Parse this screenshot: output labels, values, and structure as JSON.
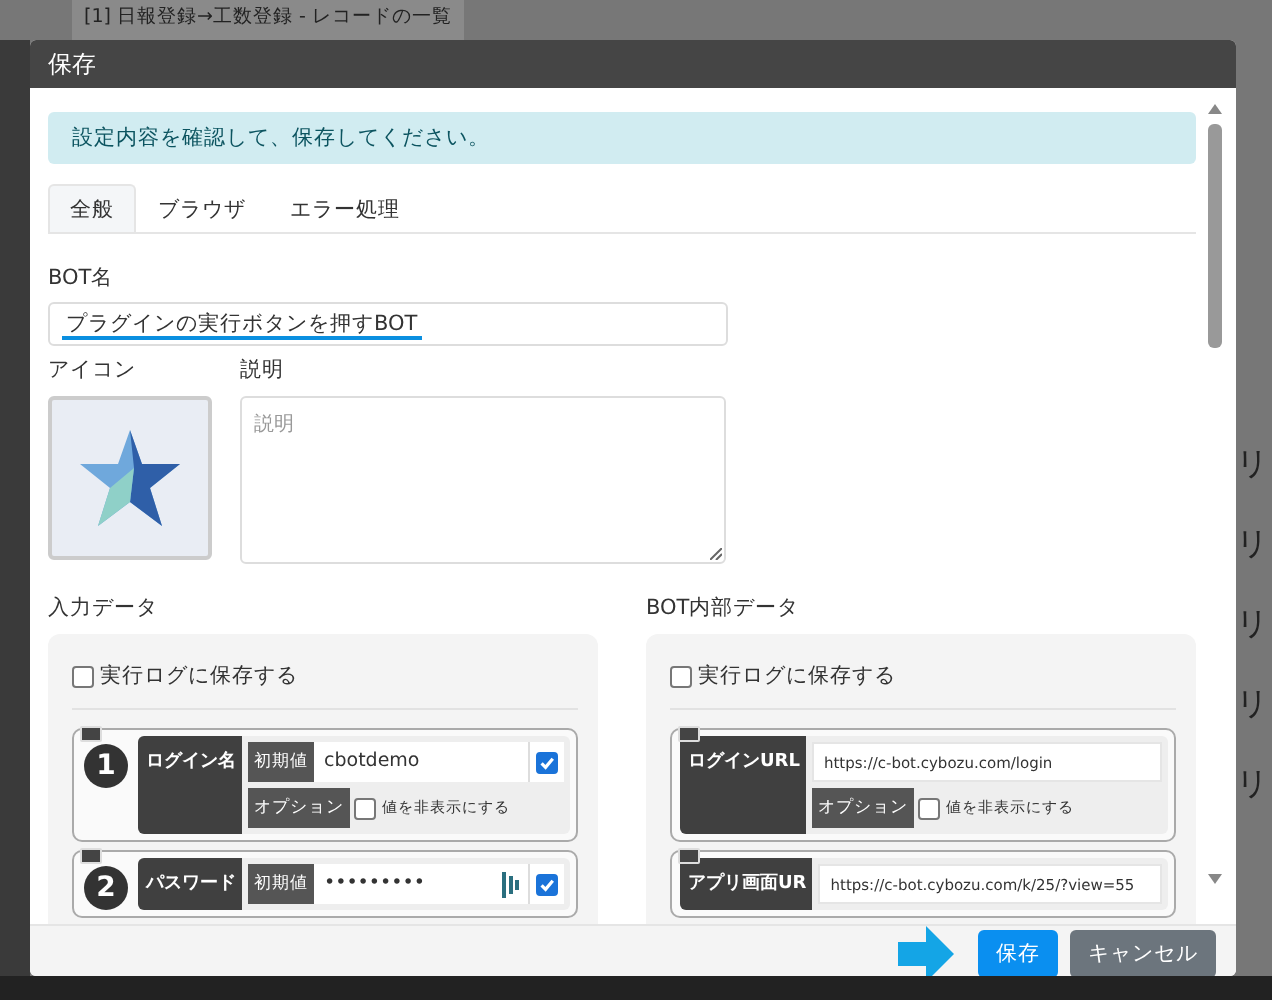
{
  "background": {
    "tab_title": "[1] 日報登録→工数登録 - レコードの一覧",
    "side_marks": [
      "リ",
      "リ",
      "リ",
      "リ",
      "リ"
    ]
  },
  "dialog": {
    "title": "保存",
    "alert": "設定内容を確認して、保存してください。",
    "tabs": [
      {
        "label": "全般",
        "selected": true
      },
      {
        "label": "ブラウザ",
        "selected": false
      },
      {
        "label": "エラー処理",
        "selected": false
      }
    ],
    "bot_name": {
      "label": "BOT名",
      "value": "プラグインの実行ボタンを押すBOT"
    },
    "icon_label": "アイコン",
    "description": {
      "label": "説明",
      "placeholder": "説明"
    },
    "sections": [
      {
        "title": "入力データ",
        "log": {
          "label": "実行ログに保存する",
          "checked": false
        },
        "params": [
          {
            "number": "1",
            "name": "ログイン名",
            "rows": [
              {
                "kind": "value",
                "label": "初期値",
                "value": "cbotdemo",
                "checked": true
              },
              {
                "kind": "option",
                "label": "オプション",
                "option": "値を非表示にする",
                "checked": false
              }
            ]
          },
          {
            "number": "2",
            "name": "パスワード",
            "rows": [
              {
                "kind": "secret",
                "label": "初期値",
                "value": "•••••••••",
                "checked": true
              }
            ]
          }
        ]
      },
      {
        "title": "BOT内部データ",
        "log": {
          "label": "実行ログに保存する",
          "checked": false
        },
        "params": [
          {
            "name": "ログインURL",
            "rows": [
              {
                "kind": "url",
                "value": "https://c-bot.cybozu.com/login"
              },
              {
                "kind": "option",
                "label": "オプション",
                "option": "値を非表示にする",
                "checked": false
              }
            ]
          },
          {
            "name": "アプリ画面UR",
            "rows": [
              {
                "kind": "url",
                "value": "https://c-bot.cybozu.com/k/25/?view=55"
              }
            ]
          }
        ]
      }
    ],
    "buttons": [
      {
        "label": "保存",
        "kind": "primary"
      },
      {
        "label": "キャンセル",
        "kind": "secondary"
      }
    ]
  }
}
